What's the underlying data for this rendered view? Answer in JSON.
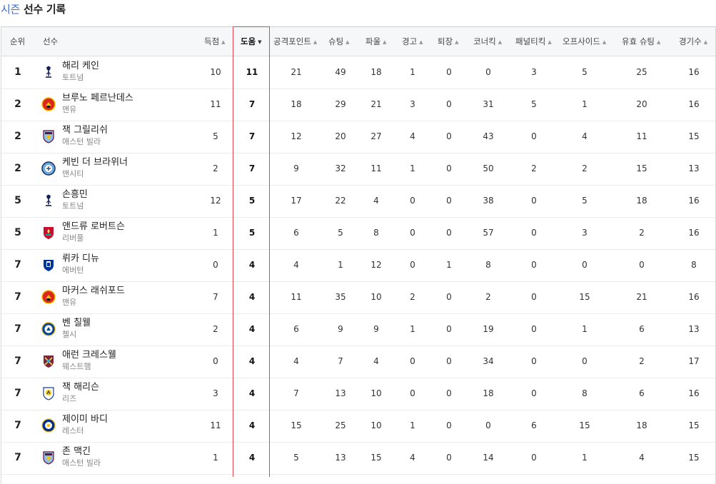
{
  "title": {
    "season": "시즌",
    "rest": " 선수 기록"
  },
  "headers": {
    "rank": "순위",
    "player": "선수",
    "goals": "득점",
    "assists": "도움",
    "attack_points": "공격포인트",
    "shots": "슈팅",
    "fouls": "파울",
    "yellow": "경고",
    "red": "퇴장",
    "corners": "코너킥",
    "penalties": "패널티킥",
    "offsides": "오프사이드",
    "on_target": "유효 슈팅",
    "games": "경기수"
  },
  "sort_arrow": "▲",
  "active_arrow": "▼",
  "rows": [
    {
      "rank": "1",
      "name": "해리 케인",
      "team": "토트넘",
      "crest": "spurs",
      "goals": "10",
      "assists": "11",
      "ap": "21",
      "shots": "49",
      "fouls": "18",
      "yellow": "1",
      "red": "0",
      "corners": "0",
      "pk": "3",
      "offside": "5",
      "sot": "25",
      "games": "16"
    },
    {
      "rank": "2",
      "name": "브루노 페르난데스",
      "team": "맨유",
      "crest": "manutd",
      "goals": "11",
      "assists": "7",
      "ap": "18",
      "shots": "29",
      "fouls": "21",
      "yellow": "3",
      "red": "0",
      "corners": "31",
      "pk": "5",
      "offside": "1",
      "sot": "20",
      "games": "16"
    },
    {
      "rank": "2",
      "name": "잭 그릴리쉬",
      "team": "애스턴 빌라",
      "crest": "villa",
      "goals": "5",
      "assists": "7",
      "ap": "12",
      "shots": "20",
      "fouls": "27",
      "yellow": "4",
      "red": "0",
      "corners": "43",
      "pk": "0",
      "offside": "4",
      "sot": "11",
      "games": "15"
    },
    {
      "rank": "2",
      "name": "케빈 더 브라위너",
      "team": "맨시티",
      "crest": "mancity",
      "goals": "2",
      "assists": "7",
      "ap": "9",
      "shots": "32",
      "fouls": "11",
      "yellow": "1",
      "red": "0",
      "corners": "50",
      "pk": "2",
      "offside": "2",
      "sot": "15",
      "games": "13"
    },
    {
      "rank": "5",
      "name": "손흥민",
      "team": "토트넘",
      "crest": "spurs",
      "goals": "12",
      "assists": "5",
      "ap": "17",
      "shots": "22",
      "fouls": "4",
      "yellow": "0",
      "red": "0",
      "corners": "38",
      "pk": "0",
      "offside": "5",
      "sot": "18",
      "games": "16"
    },
    {
      "rank": "5",
      "name": "앤드류 로버트슨",
      "team": "리버풀",
      "crest": "liverpool",
      "goals": "1",
      "assists": "5",
      "ap": "6",
      "shots": "5",
      "fouls": "8",
      "yellow": "0",
      "red": "0",
      "corners": "57",
      "pk": "0",
      "offside": "3",
      "sot": "2",
      "games": "16"
    },
    {
      "rank": "7",
      "name": "뤼카 디뉴",
      "team": "에버턴",
      "crest": "everton",
      "goals": "0",
      "assists": "4",
      "ap": "4",
      "shots": "1",
      "fouls": "12",
      "yellow": "0",
      "red": "1",
      "corners": "8",
      "pk": "0",
      "offside": "0",
      "sot": "0",
      "games": "8"
    },
    {
      "rank": "7",
      "name": "마커스 래쉬포드",
      "team": "맨유",
      "crest": "manutd",
      "goals": "7",
      "assists": "4",
      "ap": "11",
      "shots": "35",
      "fouls": "10",
      "yellow": "2",
      "red": "0",
      "corners": "2",
      "pk": "0",
      "offside": "15",
      "sot": "21",
      "games": "16"
    },
    {
      "rank": "7",
      "name": "벤 칠웰",
      "team": "첼시",
      "crest": "chelsea",
      "goals": "2",
      "assists": "4",
      "ap": "6",
      "shots": "9",
      "fouls": "9",
      "yellow": "1",
      "red": "0",
      "corners": "19",
      "pk": "0",
      "offside": "1",
      "sot": "6",
      "games": "13"
    },
    {
      "rank": "7",
      "name": "애런 크레스웰",
      "team": "웨스트햄",
      "crest": "westham",
      "goals": "0",
      "assists": "4",
      "ap": "4",
      "shots": "7",
      "fouls": "4",
      "yellow": "0",
      "red": "0",
      "corners": "34",
      "pk": "0",
      "offside": "0",
      "sot": "2",
      "games": "17"
    },
    {
      "rank": "7",
      "name": "잭 해리슨",
      "team": "리즈",
      "crest": "leeds",
      "goals": "3",
      "assists": "4",
      "ap": "7",
      "shots": "13",
      "fouls": "10",
      "yellow": "0",
      "red": "0",
      "corners": "18",
      "pk": "0",
      "offside": "8",
      "sot": "6",
      "games": "16"
    },
    {
      "rank": "7",
      "name": "제이미 바디",
      "team": "레스터",
      "crest": "leicester",
      "goals": "11",
      "assists": "4",
      "ap": "15",
      "shots": "25",
      "fouls": "10",
      "yellow": "1",
      "red": "0",
      "corners": "0",
      "pk": "6",
      "offside": "15",
      "sot": "18",
      "games": "15"
    },
    {
      "rank": "7",
      "name": "존 맥긴",
      "team": "애스턴 빌라",
      "crest": "villa",
      "goals": "1",
      "assists": "4",
      "ap": "5",
      "shots": "13",
      "fouls": "15",
      "yellow": "4",
      "red": "0",
      "corners": "14",
      "pk": "0",
      "offside": "1",
      "sot": "4",
      "games": "15"
    }
  ],
  "colors": {
    "accent": "#3b6fd8",
    "highlight_border": "#e8434c",
    "header_bg": "#f6f7f9"
  }
}
